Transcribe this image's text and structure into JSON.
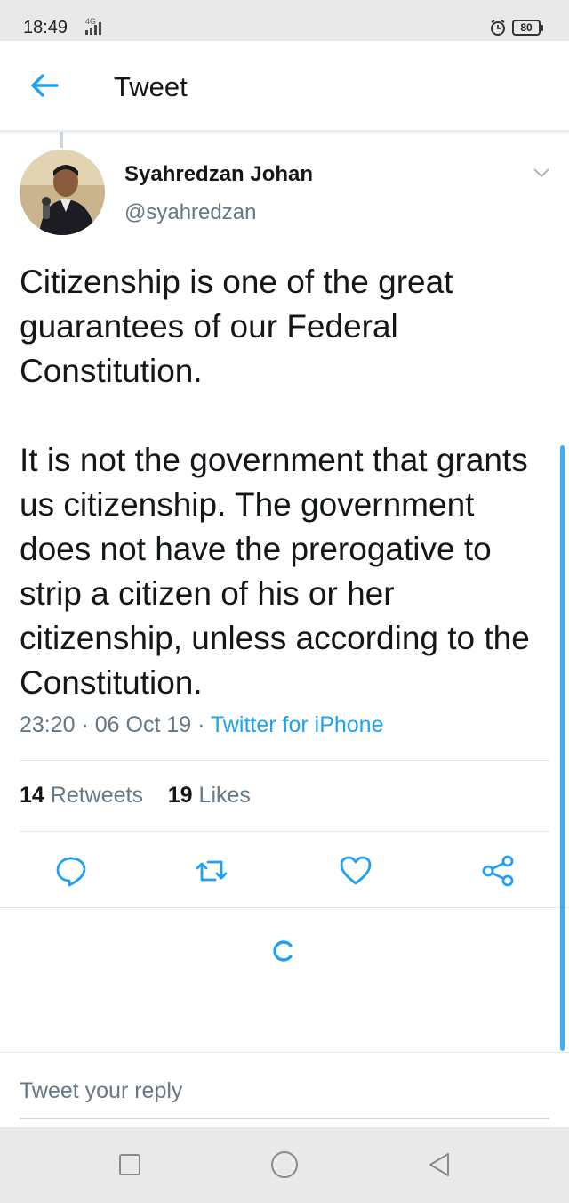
{
  "status_bar": {
    "time": "18:49",
    "network": "4G",
    "battery": "80"
  },
  "header": {
    "title": "Tweet",
    "back_icon": "arrow-left-icon"
  },
  "tweet": {
    "author_name": "Syahredzan Johan",
    "author_handle": "@syahredzan",
    "text": "Citizenship is one of the great guarantees of our Federal Constitution.\n\nIt is not the government that grants us citizenship. The government does not have the prerogative to strip a citizen of his or her citizenship, unless according to the Constitution.",
    "timestamp": "23:20 · 06 Oct 19 · ",
    "source": "Twitter for iPhone",
    "retweet_count": "14",
    "retweets_label": "Retweets",
    "like_count": "19",
    "likes_label": "Likes"
  },
  "actions": [
    "reply-icon",
    "retweet-icon",
    "like-icon",
    "share-icon"
  ],
  "reply": {
    "placeholder": "Tweet your reply"
  },
  "colors": {
    "accent": "#1da1f2",
    "secondary_text": "#657786"
  }
}
